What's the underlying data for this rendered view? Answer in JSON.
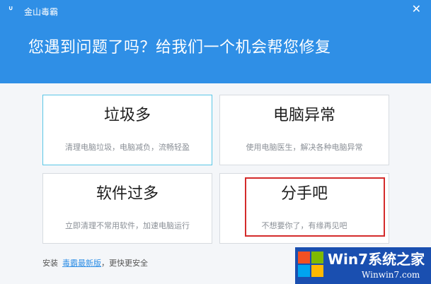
{
  "window": {
    "app_title": "金山毒霸",
    "logo_glyph": "ᐡ",
    "close_glyph": "✕"
  },
  "header": {
    "headline": "您遇到问题了吗？给我们一个机会帮您修复"
  },
  "options": [
    {
      "title": "垃圾多",
      "desc": "清理电脑垃圾，电脑减负，流畅轻盈"
    },
    {
      "title": "电脑异常",
      "desc": "使用电脑医生，解决各种电脑异常"
    },
    {
      "title": "软件过多",
      "desc": "立即清理不常用软件，加速电脑运行"
    },
    {
      "title": "分手吧",
      "desc": "不想要你了，有缘再见吧"
    }
  ],
  "footer": {
    "prefix": "安装",
    "link": "毒霸最新版",
    "suffix": "，更快更安全"
  },
  "watermark": {
    "main": "Win7系统之家",
    "url": "Winwin7.com"
  },
  "colors": {
    "header_bg": "#2f8fe6",
    "active_card_border": "#5ac6e6",
    "highlight_box": "#d42b2b",
    "link": "#2f8fe6"
  }
}
